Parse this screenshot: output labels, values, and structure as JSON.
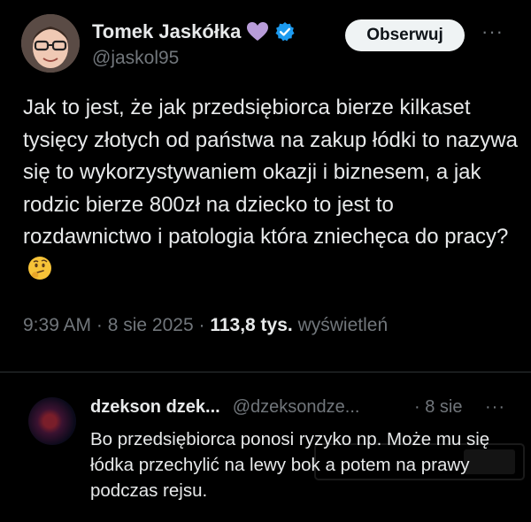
{
  "post": {
    "display_name": "Tomek Jaskółka",
    "handle": "@jaskol95",
    "follow_label": "Obserwuj",
    "more_label": "···",
    "text": "Jak to jest, że jak przedsiębiorca bierze kilkaset tysięcy złotych od państwa na zakup łódki to nazywa się to wykorzystywaniem okazji i biznesem, a jak rodzic bierze 800zł na dziecko to jest to rozdawnictwo i patologia która zniechęca do pracy?",
    "emoji_icon": "thinking-face-icon",
    "time": "9:39 AM",
    "sep1": " · ",
    "date": "8 sie 2025",
    "sep2": " · ",
    "views_count": "113,8 tys.",
    "views_label": "wyświetleń",
    "heart_color": "#b89cd9",
    "verified_color": "#1d9bf0"
  },
  "reply": {
    "display_name": "dzekson dzek...",
    "handle": "@dzeksondze...",
    "time": "· 8 sie",
    "more_label": "···",
    "text": "Bo przedsiębiorca ponosi ryzyko np. Może mu się łódka przechylić na lewy bok a potem na prawy podczas rejsu."
  }
}
